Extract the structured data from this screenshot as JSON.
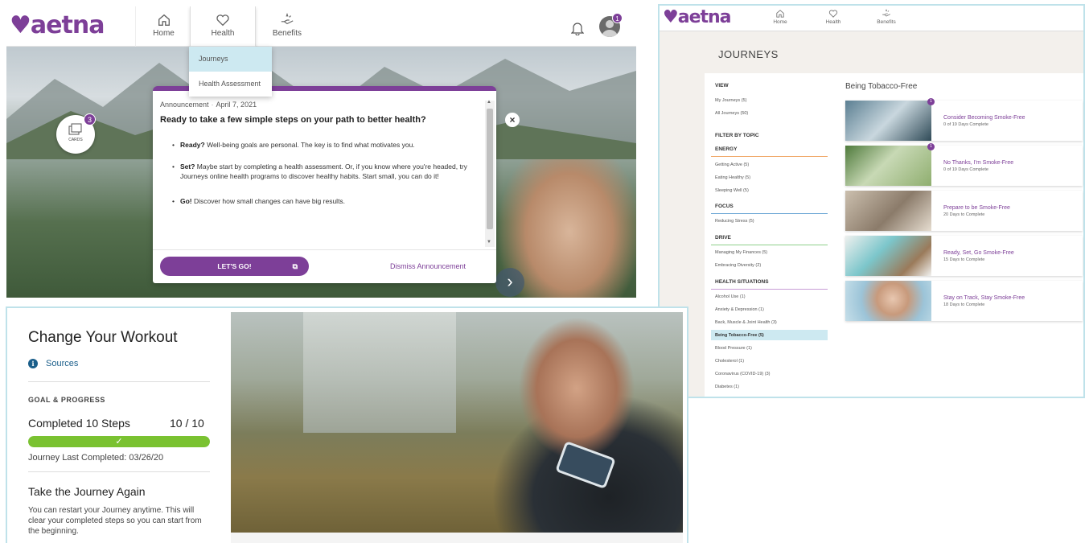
{
  "brand": {
    "logo_text": "aetna",
    "accent": "#7d3f98",
    "link_color": "#1a5e8a",
    "highlight": "#cde9f1"
  },
  "panel_a": {
    "nav": {
      "home": "Home",
      "health": "Health",
      "benefits": "Benefits"
    },
    "icons": [
      "home-icon",
      "heart-icon",
      "benefits-icon",
      "bell-icon",
      "avatar"
    ],
    "avatar_badge": "1",
    "cards_label": "CARDS",
    "cards_badge": "3",
    "close_label": "×",
    "next_label": "›",
    "dropdown": [
      "Journeys",
      "Health Assessment"
    ],
    "announcement": {
      "label": "Announcement",
      "date": "April 7, 2021",
      "title": "Ready to take a few simple steps on your path to better health?",
      "bullets": [
        {
          "lead": "Ready?",
          "text": " Well-being goals are personal. The key is to find what motivates you."
        },
        {
          "lead": "Set?",
          "text": " Maybe start by completing a health assessment. Or, if you know where you're headed, try Journeys online health programs to discover healthy habits. Start small, you can do it!"
        },
        {
          "lead": "Go!",
          "text": " Discover how small changes can have big results."
        }
      ],
      "cta": "LET'S GO!",
      "dismiss": "Dismiss Announcement"
    }
  },
  "panel_b": {
    "nav": {
      "home": "Home",
      "health": "Health",
      "benefits": "Benefits"
    },
    "page_title": "JOURNEYS",
    "view": {
      "heading": "VIEW",
      "items": [
        "My Journeys (5)",
        "All Journeys (50)"
      ]
    },
    "filter_heading": "FILTER BY TOPIC",
    "topics": [
      {
        "heading": "ENERGY",
        "color": "#f0a868",
        "items": [
          "Getting Active (5)",
          "Eating Healthy (5)",
          "Sleeping Well (5)"
        ]
      },
      {
        "heading": "FOCUS",
        "color": "#6fa8d6",
        "items": [
          "Reducing Stress (5)"
        ]
      },
      {
        "heading": "DRIVE",
        "color": "#8fcf8a",
        "items": [
          "Managing My Finances (5)",
          "Embracing Diversity (2)"
        ]
      },
      {
        "heading": "HEALTH SITUATIONS",
        "color": "#c79bd6",
        "items": [
          "Alcohol Use (1)",
          "Anxiety & Depression (1)",
          "Back, Muscle & Joint Health (3)",
          "Being Tobacco-Free (5)",
          "Blood Pressure (1)",
          "Cholesterol (1)",
          "Coronavirus (COVID-19) (3)",
          "Diabetes (1)"
        ]
      }
    ],
    "selected_topic": "Being Tobacco-Free (5)",
    "results_heading": "Being Tobacco-Free",
    "journeys": [
      {
        "title": "Consider Becoming Smoke-Free",
        "status": "0 of 19 Days Complete",
        "badge": "1"
      },
      {
        "title": "No Thanks, I'm Smoke-Free",
        "status": "0 of 19 Days Complete",
        "badge": "1"
      },
      {
        "title": "Prepare to be Smoke-Free",
        "status": "20 Days to Complete",
        "badge": ""
      },
      {
        "title": "Ready, Set, Go Smoke-Free",
        "status": "15 Days to Complete",
        "badge": ""
      },
      {
        "title": "Stay on Track, Stay Smoke-Free",
        "status": "18 Days to Complete",
        "badge": ""
      }
    ]
  },
  "panel_c": {
    "title": "Change Your Workout",
    "sources": "Sources",
    "goal_heading": "GOAL & PROGRESS",
    "steps_label": "Completed 10 Steps",
    "count": "10 / 10",
    "progress": 1.0,
    "progress_color": "#7ac231",
    "check": "✓",
    "last_completed": "Journey Last Completed: 03/26/20",
    "again_title": "Take the Journey Again",
    "again_text": "You can restart your Journey anytime. This will clear your completed steps so you can start from the beginning."
  }
}
